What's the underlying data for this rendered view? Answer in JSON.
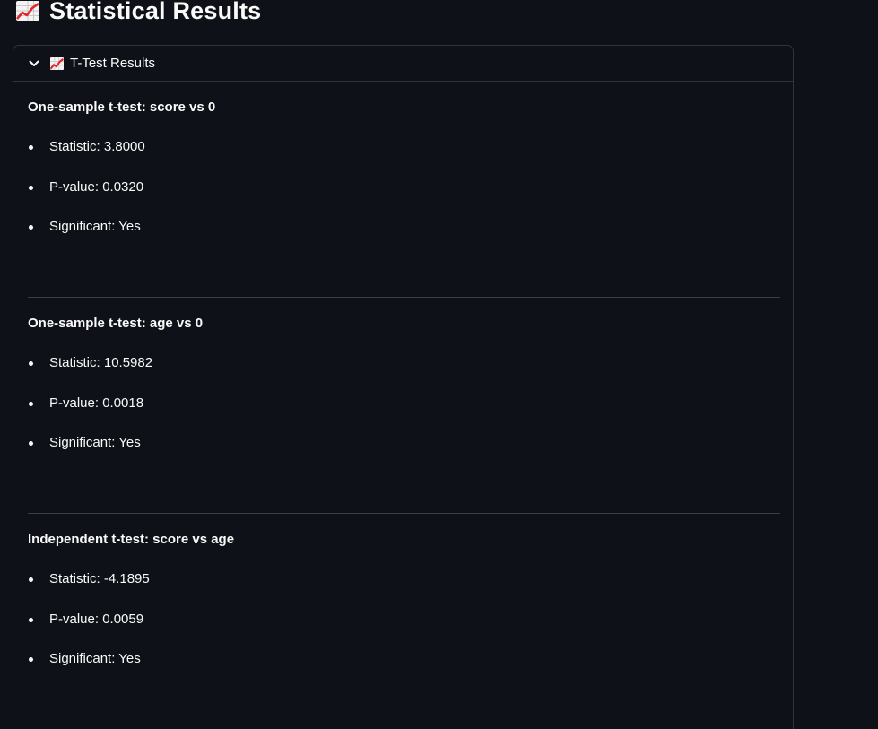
{
  "header": {
    "title": "Statistical Results",
    "icon": "chart-increasing-icon"
  },
  "expander": {
    "label": "T-Test Results",
    "icon": "chart-increasing-icon",
    "expanded": true
  },
  "sections": [
    {
      "title": "One-sample t-test: score vs 0",
      "items": [
        "Statistic: 3.8000",
        "P-value: 0.0320",
        "Significant: Yes"
      ]
    },
    {
      "title": "One-sample t-test: age vs 0",
      "items": [
        "Statistic: 10.5982",
        "P-value: 0.0018",
        "Significant: Yes"
      ]
    },
    {
      "title": "Independent t-test: score vs age",
      "items": [
        "Statistic: -4.1895",
        "P-value: 0.0059",
        "Significant: Yes"
      ]
    }
  ],
  "colors": {
    "background": "#0e1117",
    "text": "#fafafa",
    "border": "#31333f",
    "chart_line": "#e0262b"
  }
}
